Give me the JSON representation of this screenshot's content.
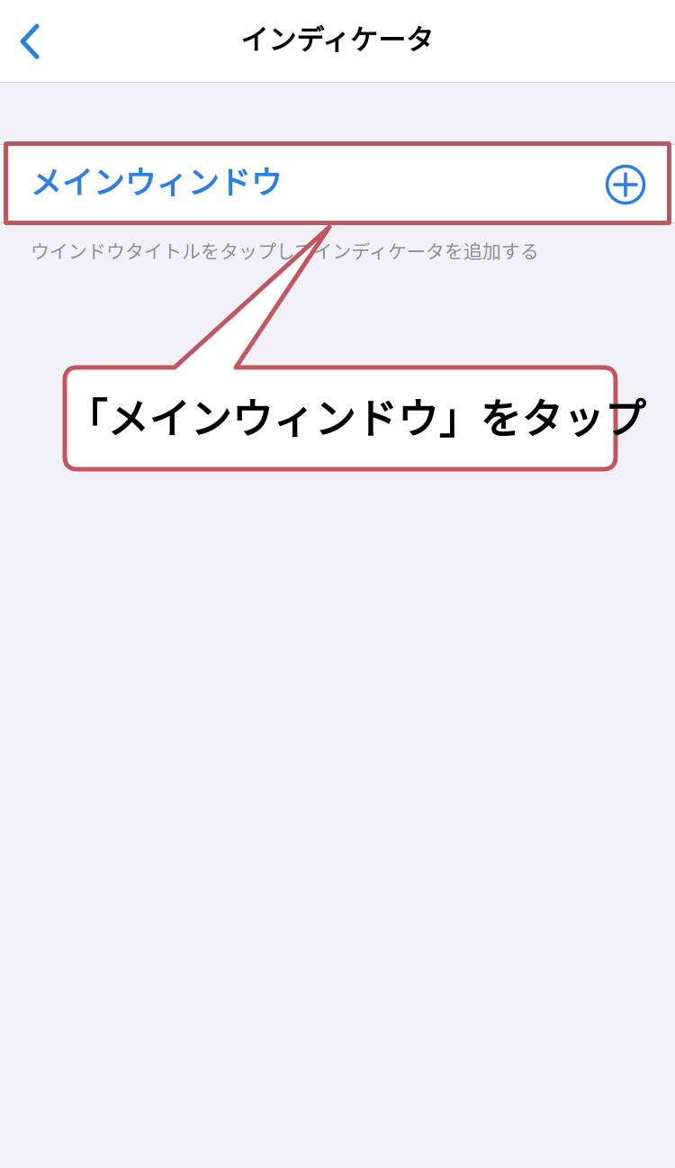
{
  "nav": {
    "title": "インディケータ",
    "back_icon": "chevron-left-icon"
  },
  "list": {
    "row_label": "メインウィンドウ",
    "add_icon": "plus-circle-icon",
    "footer": "ウインドウタイトルをタップしてインディケータを追加する"
  },
  "annotation": {
    "callout_text": "「メインウィンドウ」をタップ"
  },
  "colors": {
    "accent": "#2a7ee8",
    "background": "#f2f1f7",
    "annotation": "#c2555f"
  }
}
